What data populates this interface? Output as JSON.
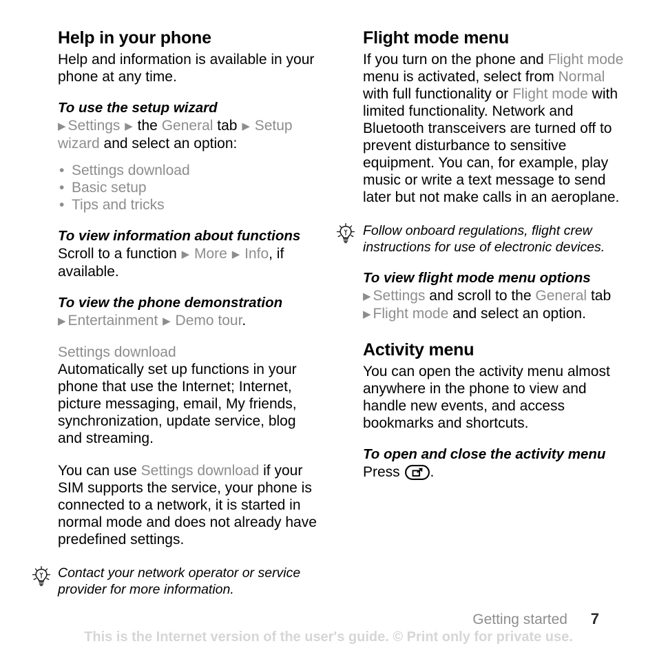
{
  "document": {
    "left_column": {
      "section_title": "Help in your phone",
      "intro": "Help and information is available in your phone at any time.",
      "task_setup_wizard": {
        "title": "To use the setup wizard",
        "path_settings": "Settings",
        "path_the": "the",
        "path_general": "General",
        "path_tab": "tab",
        "path_setup_wizard": "Setup wizard",
        "path_tail": "and select an option:",
        "options": [
          "Settings download",
          "Basic setup",
          "Tips and tricks"
        ]
      },
      "task_view_info": {
        "title": "To view information about functions",
        "lead": "Scroll to a function",
        "path_more": "More",
        "path_info": "Info",
        "tail": ", if available."
      },
      "task_demo": {
        "title": "To view the phone demonstration",
        "path_entertainment": "Entertainment",
        "path_demo_tour": "Demo tour",
        "tail": "."
      },
      "settings_download": {
        "heading": "Settings download",
        "paragraph1": "Automatically set up functions in your phone that use the Internet; Internet, picture messaging, email, My friends, synchronization, update service, blog and streaming.",
        "paragraph2_lead": "You can use",
        "paragraph2_link": "Settings download",
        "paragraph2_tail": "if your SIM supports the service, your phone is connected to a network, it is started in normal mode and does not already have predefined settings."
      },
      "note": "Contact your network operator or service provider for more information."
    },
    "right_column": {
      "section_title": "Flight mode menu",
      "intro_part1": "If you turn on the phone and",
      "intro_flight_mode_1": "Flight mode",
      "intro_part2": "menu is activated, select from",
      "intro_normal": "Normal",
      "intro_part3": "with full functionality or",
      "intro_flight_mode_2": "Flight mode",
      "intro_part4": "with limited functionality. Network and Bluetooth transceivers are turned off to prevent disturbance to sensitive equipment. You can, for example, play music or write a text message to send later but not make calls in an aeroplane.",
      "note": "Follow onboard regulations, flight crew instructions for use of electronic devices.",
      "task_flight_options": {
        "title": "To view flight mode menu options",
        "line1_settings": "Settings",
        "line1_mid": "and scroll to the",
        "line1_general": "General",
        "line1_tail": "tab",
        "line2_flight_mode": "Flight mode",
        "line2_tail": "and select an option."
      },
      "activity_menu": {
        "section_title": "Activity menu",
        "paragraph": "You can open the activity menu almost anywhere in the phone to view and handle new events, and access bookmarks and shortcuts.",
        "task_title": "To open and close the activity menu",
        "press_label": "Press",
        "press_tail": "."
      }
    },
    "footer": {
      "chapter": "Getting started",
      "page_number": "7",
      "disclaimer": "This is the Internet version of the user's guide. © Print only for private use."
    },
    "icons": {
      "tip": "lightbulb-icon",
      "activity_key": "activity-menu-key-icon",
      "arrow": "▶"
    },
    "colors": {
      "menu_gray": "#8d8d8d",
      "text_black": "#000000",
      "disclaimer_gray": "#d6d6d6"
    }
  }
}
